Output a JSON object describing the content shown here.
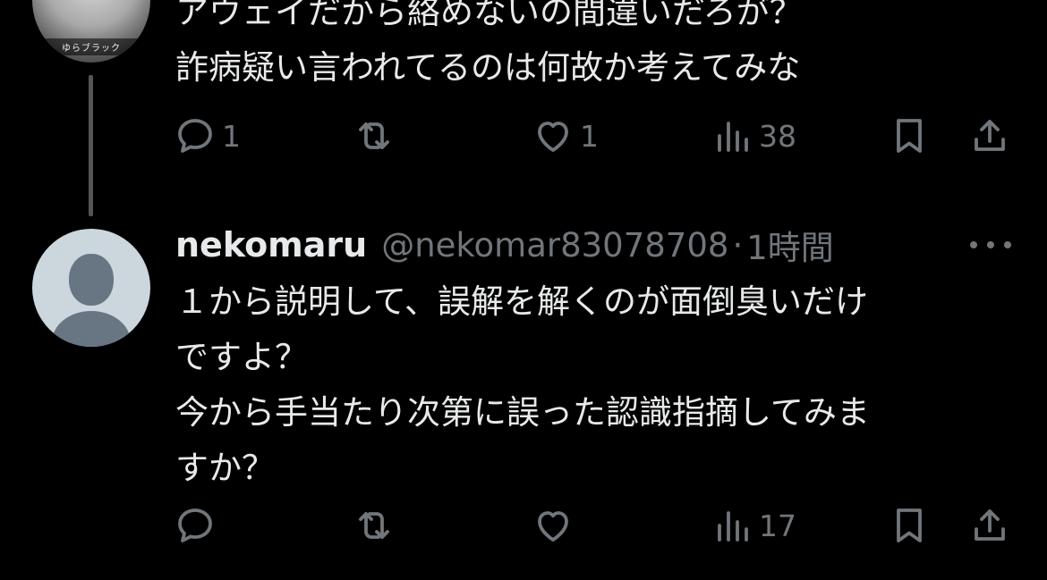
{
  "tweet_prev": {
    "avatar_caption": "ゆらブラック",
    "text_lines": [
      "アウェイだから絡めないの間違いだろが？",
      "詐病疑い言われてるのは何故か考えてみな"
    ],
    "reply_count": "1",
    "repost_count": "",
    "like_count": "1",
    "views_count": "38"
  },
  "tweet_reply": {
    "display_name": "nekomaru",
    "handle": "@nekomar83078708",
    "separator": "·",
    "time": "1時間",
    "text_lines": [
      "１から説明して、誤解を解くのが面倒臭いだけ",
      "ですよ？",
      "今から手当たり次第に誤った認識指摘してみま",
      "すか？"
    ],
    "reply_count": "",
    "repost_count": "",
    "like_count": "",
    "views_count": "17"
  },
  "icons": {
    "reply": "speech-bubble-icon",
    "repost": "repost-arrows-icon",
    "like": "heart-icon",
    "views": "bar-chart-icon",
    "bookmark": "bookmark-icon",
    "share": "share-upload-icon",
    "more": "more-dots-icon"
  },
  "colors": {
    "background": "#000000",
    "text": "#e7e9ea",
    "secondary": "#71767b",
    "thread_line": "#555555",
    "default_avatar_bg": "#ccd6dd"
  }
}
